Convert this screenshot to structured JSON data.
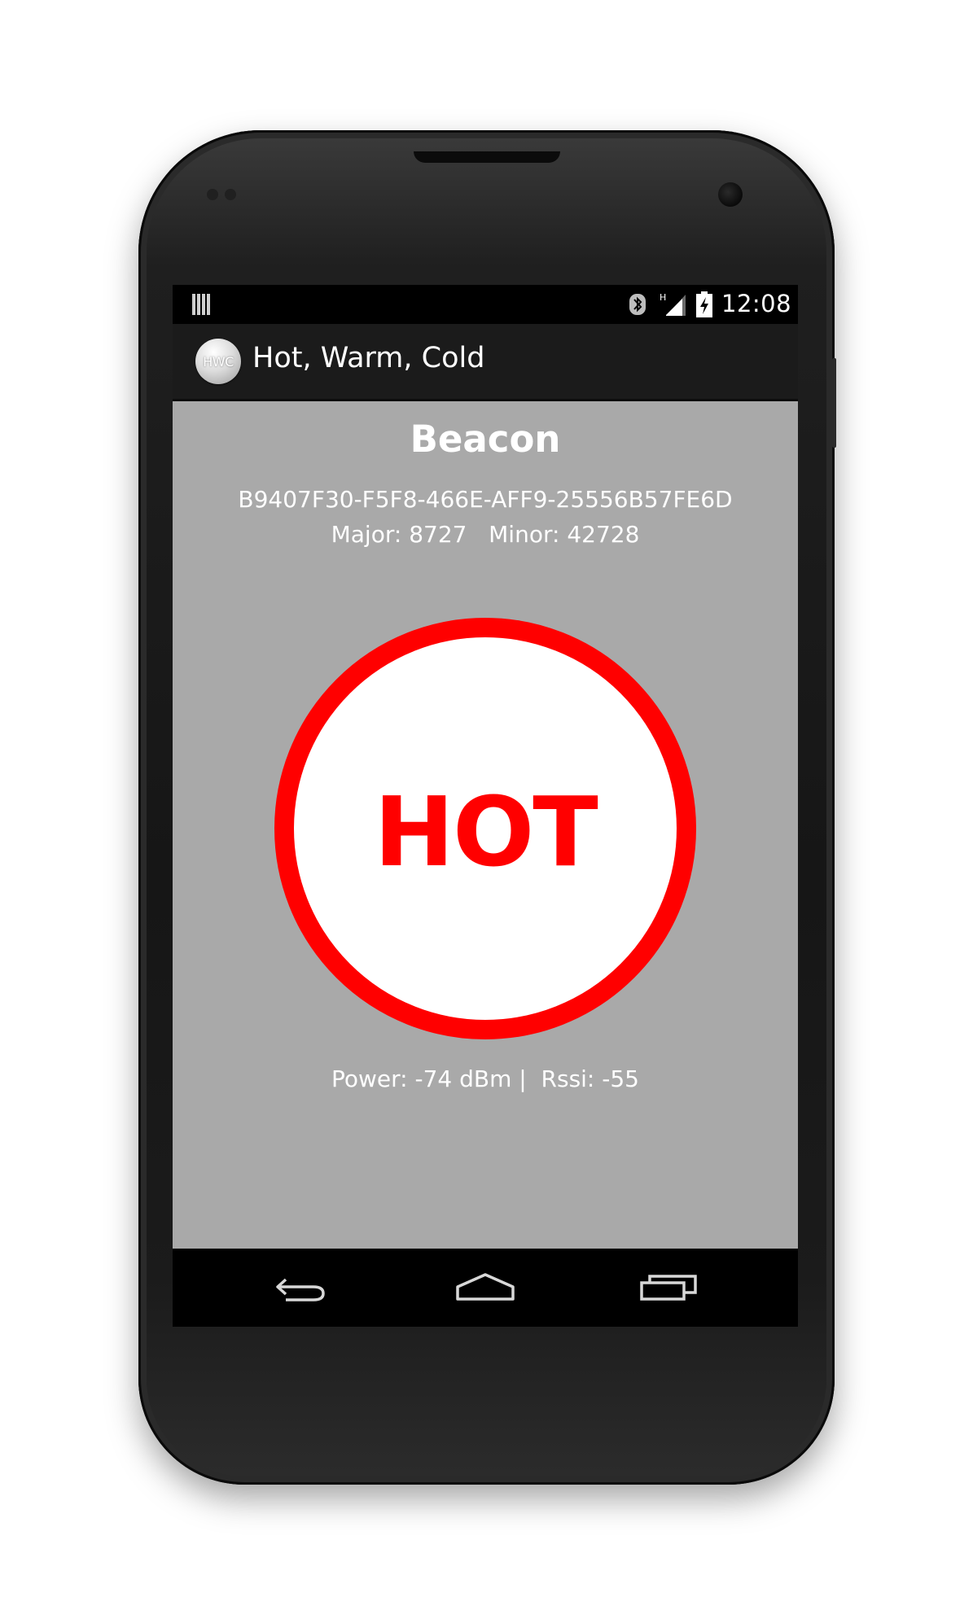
{
  "status_bar": {
    "time": "12:08",
    "network_indicator": "H",
    "icons": [
      "notification-icon",
      "bluetooth-icon",
      "signal-icon",
      "battery-charging-icon"
    ]
  },
  "action_bar": {
    "logo_text": "HWC",
    "title": "Hot, Warm, Cold"
  },
  "beacon": {
    "title": "Beacon",
    "uuid": "B9407F30-F5F8-466E-AFF9-25556B57FE6D",
    "ids_line": "Major: 8727   Minor: 42728"
  },
  "proximity": {
    "label": "HOT",
    "color": "#ff0000"
  },
  "signal": {
    "readout": "Power: -74 dBm |  Rssi: -55"
  },
  "nav_bar": {
    "buttons": [
      "back-icon",
      "home-icon",
      "recent-apps-icon"
    ]
  },
  "colors": {
    "content_background": "#a9a9a9",
    "action_bar": "#1b1b1b",
    "accent_red": "#ff0000"
  }
}
